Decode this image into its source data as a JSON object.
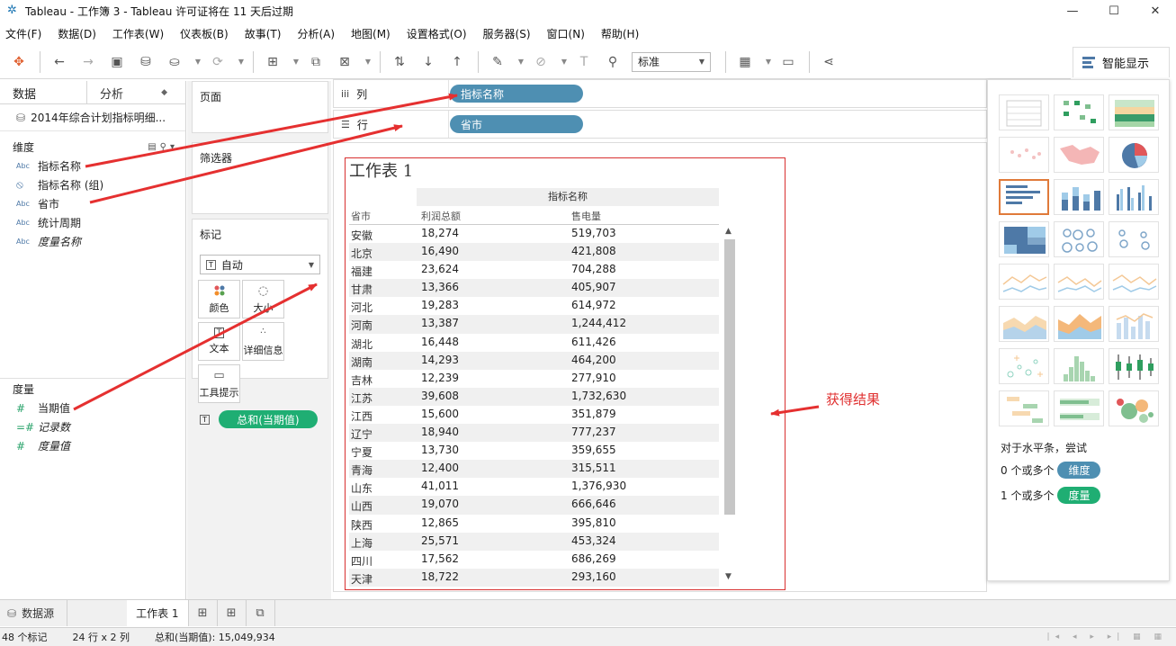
{
  "window": {
    "title": "Tableau - 工作簿 3 - Tableau 许可证将在 11 天后过期"
  },
  "menu": [
    "文件(F)",
    "数据(D)",
    "工作表(W)",
    "仪表板(B)",
    "故事(T)",
    "分析(A)",
    "地图(M)",
    "设置格式(O)",
    "服务器(S)",
    "窗口(N)",
    "帮助(H)"
  ],
  "toolbar": {
    "fit_select": "标准",
    "smart_show_label": "智能显示"
  },
  "left_pane": {
    "tab_data": "数据",
    "tab_analysis": "分析",
    "datasource": "2014年综合计划指标明细...",
    "dimensions_header": "维度",
    "dimensions": [
      {
        "type": "Abc",
        "name": "指标名称",
        "italic": false
      },
      {
        "type": "clip",
        "name": "指标名称 (组)",
        "italic": false
      },
      {
        "type": "Abc",
        "name": "省市",
        "italic": false
      },
      {
        "type": "Abc",
        "name": "统计周期",
        "italic": false
      },
      {
        "type": "Abc",
        "name": "度量名称",
        "italic": true
      }
    ],
    "measures_header": "度量",
    "measures": [
      {
        "type": "#",
        "name": "当期值",
        "italic": false
      },
      {
        "type": "=#",
        "name": "记录数",
        "italic": true
      },
      {
        "type": "#",
        "name": "度量值",
        "italic": true
      }
    ]
  },
  "cards": {
    "pages": "页面",
    "filters": "筛选器",
    "marks": "标记",
    "marks_type": "自动",
    "mark_buttons": [
      "颜色",
      "大小",
      "文本",
      "详细信息",
      "工具提示"
    ],
    "marks_pill": "总和(当期值)"
  },
  "shelves": {
    "columns_label": "列",
    "columns_pill": "指标名称",
    "rows_label": "行",
    "rows_pill": "省市"
  },
  "worksheet": {
    "title": "工作表 1",
    "col_group_header": "指标名称",
    "row_header": "省市",
    "col_headers": [
      "利润总额",
      "售电量"
    ],
    "rows": [
      {
        "province": "安徽",
        "v1": "18,274",
        "v2": "519,703"
      },
      {
        "province": "北京",
        "v1": "16,490",
        "v2": "421,808"
      },
      {
        "province": "福建",
        "v1": "23,624",
        "v2": "704,288"
      },
      {
        "province": "甘肃",
        "v1": "13,366",
        "v2": "405,907"
      },
      {
        "province": "河北",
        "v1": "19,283",
        "v2": "614,972"
      },
      {
        "province": "河南",
        "v1": "13,387",
        "v2": "1,244,412"
      },
      {
        "province": "湖北",
        "v1": "16,448",
        "v2": "611,426"
      },
      {
        "province": "湖南",
        "v1": "14,293",
        "v2": "464,200"
      },
      {
        "province": "吉林",
        "v1": "12,239",
        "v2": "277,910"
      },
      {
        "province": "江苏",
        "v1": "39,608",
        "v2": "1,732,630"
      },
      {
        "province": "江西",
        "v1": "15,600",
        "v2": "351,879"
      },
      {
        "province": "辽宁",
        "v1": "18,940",
        "v2": "777,237"
      },
      {
        "province": "宁夏",
        "v1": "13,730",
        "v2": "359,655"
      },
      {
        "province": "青海",
        "v1": "12,400",
        "v2": "315,511"
      },
      {
        "province": "山东",
        "v1": "41,011",
        "v2": "1,376,930"
      },
      {
        "province": "山西",
        "v1": "19,070",
        "v2": "666,646"
      },
      {
        "province": "陕西",
        "v1": "12,865",
        "v2": "395,810"
      },
      {
        "province": "上海",
        "v1": "25,571",
        "v2": "453,324"
      },
      {
        "province": "四川",
        "v1": "17,562",
        "v2": "686,269"
      },
      {
        "province": "天津",
        "v1": "18,722",
        "v2": "293,160"
      }
    ]
  },
  "annotation": {
    "result": "获得结果"
  },
  "smart_panel": {
    "hint": "对于水平条，尝试",
    "req1_prefix": "0 个或多个",
    "req1_pill": "维度",
    "req2_prefix": "1 个或多个",
    "req2_pill": "度量"
  },
  "sheet_tabs": {
    "datasource": "数据源",
    "sheet": "工作表 1"
  },
  "status": {
    "marks": "48 个标记",
    "dims": "24 行 x 2 列",
    "sum": "总和(当期值): 15,049,934"
  },
  "colors": {
    "accent_blue": "#4e8fb2",
    "accent_green": "#1fae73",
    "annotation_red": "#e03030"
  }
}
